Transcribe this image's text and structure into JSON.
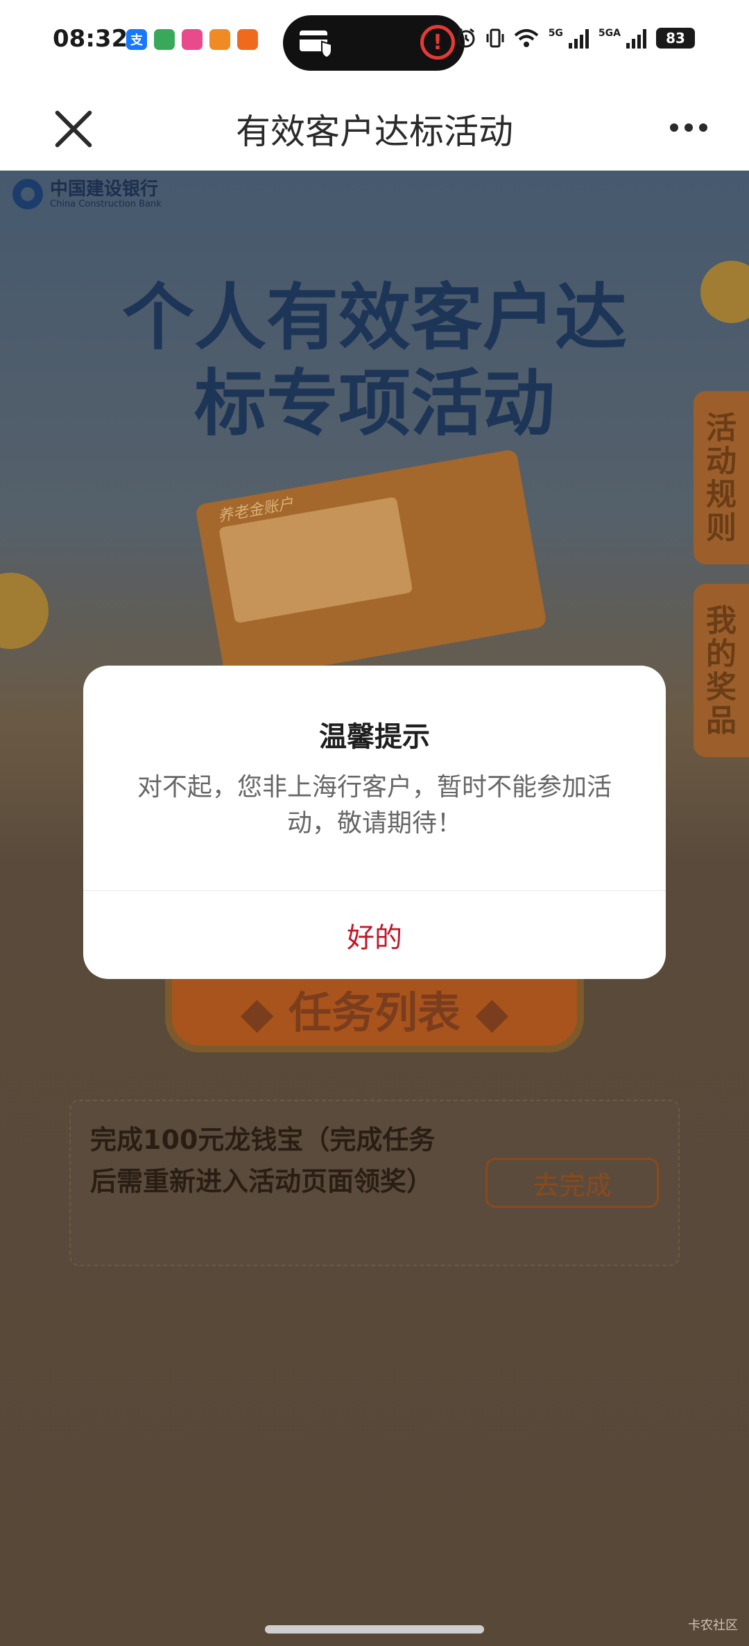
{
  "status_bar": {
    "time": "08:32",
    "app_icons": [
      {
        "name": "alipay-icon",
        "glyph": "支",
        "color": "#1677ff"
      },
      {
        "name": "app-icon-2",
        "glyph": "",
        "color": "#3aa85a"
      },
      {
        "name": "app-icon-3",
        "glyph": "",
        "color": "#e84a8c"
      },
      {
        "name": "app-icon-4",
        "glyph": "",
        "color": "#f08a24"
      },
      {
        "name": "app-icon-5",
        "glyph": "",
        "color": "#f06a1e"
      }
    ],
    "network_5g": "5G",
    "network_5ga": "5GA",
    "battery": "83"
  },
  "titlebar": {
    "title": "有效客户达标活动"
  },
  "page": {
    "bank_name_cn": "中国建设银行",
    "bank_name_en": "China Construction Bank",
    "hero_title_line1": "个人有效客户达",
    "hero_title_line2": "标专项活动",
    "hero_card_tag": "养老金账户",
    "side_tab_rules": [
      "活",
      "动",
      "规",
      "则"
    ],
    "side_tab_prizes": [
      "我",
      "的",
      "奖",
      "品"
    ],
    "task_header": "◆ 任务列表 ◆",
    "task_text": "完成100元龙钱宝（完成任务后需重新进入活动页面领奖）",
    "task_button": "去完成"
  },
  "dialog": {
    "title": "温馨提示",
    "message": "对不起，您非上海行客户，暂时不能参加活动，敬请期待！",
    "ok_label": "好的"
  },
  "watermark": "卡农社区",
  "colors": {
    "brand_red": "#c0182a",
    "hero_title": "#1d3557"
  }
}
